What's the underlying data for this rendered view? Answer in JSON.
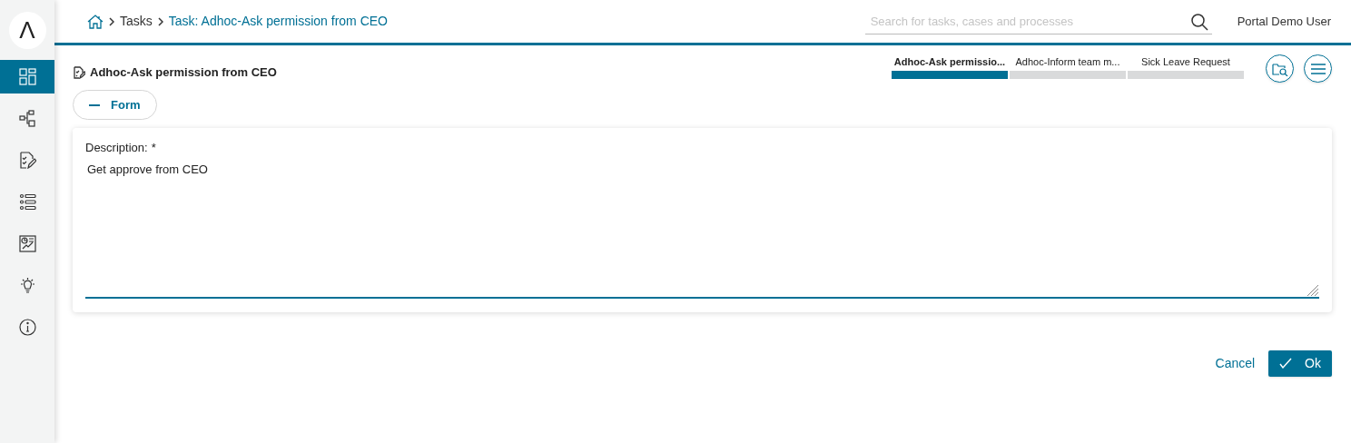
{
  "sidebar": {
    "logo": "Λ",
    "items": [
      {
        "kind": "dashboard",
        "selected": true
      },
      {
        "kind": "processes",
        "selected": false
      },
      {
        "kind": "tasks",
        "selected": false
      },
      {
        "kind": "cases",
        "selected": false
      },
      {
        "kind": "statistics",
        "selected": false
      },
      {
        "kind": "ideas",
        "selected": false
      },
      {
        "kind": "info",
        "selected": false
      }
    ]
  },
  "breadcrumb": [
    {
      "label": "Tasks",
      "current": false
    },
    {
      "label": "Task: Adhoc-Ask permission from CEO",
      "current": true
    }
  ],
  "search": {
    "placeholder": "Search for tasks, cases and processes"
  },
  "user": "Portal Demo User",
  "task_title": "Adhoc-Ask permission from CEO",
  "steps": [
    {
      "label": "Adhoc-Ask permissio...",
      "selected": true
    },
    {
      "label": "Adhoc-Inform team m...",
      "selected": false
    },
    {
      "label": "Sick Leave Request",
      "selected": false
    }
  ],
  "form_toggle": {
    "label": "Form",
    "expanded": true
  },
  "description": {
    "label": "Description:",
    "required": true,
    "required_mark": "*",
    "value": "Get approve from CEO"
  },
  "buttons": [
    {
      "kind": "link",
      "label": "Cancel"
    },
    {
      "kind": "primary",
      "label": "Ok"
    }
  ]
}
